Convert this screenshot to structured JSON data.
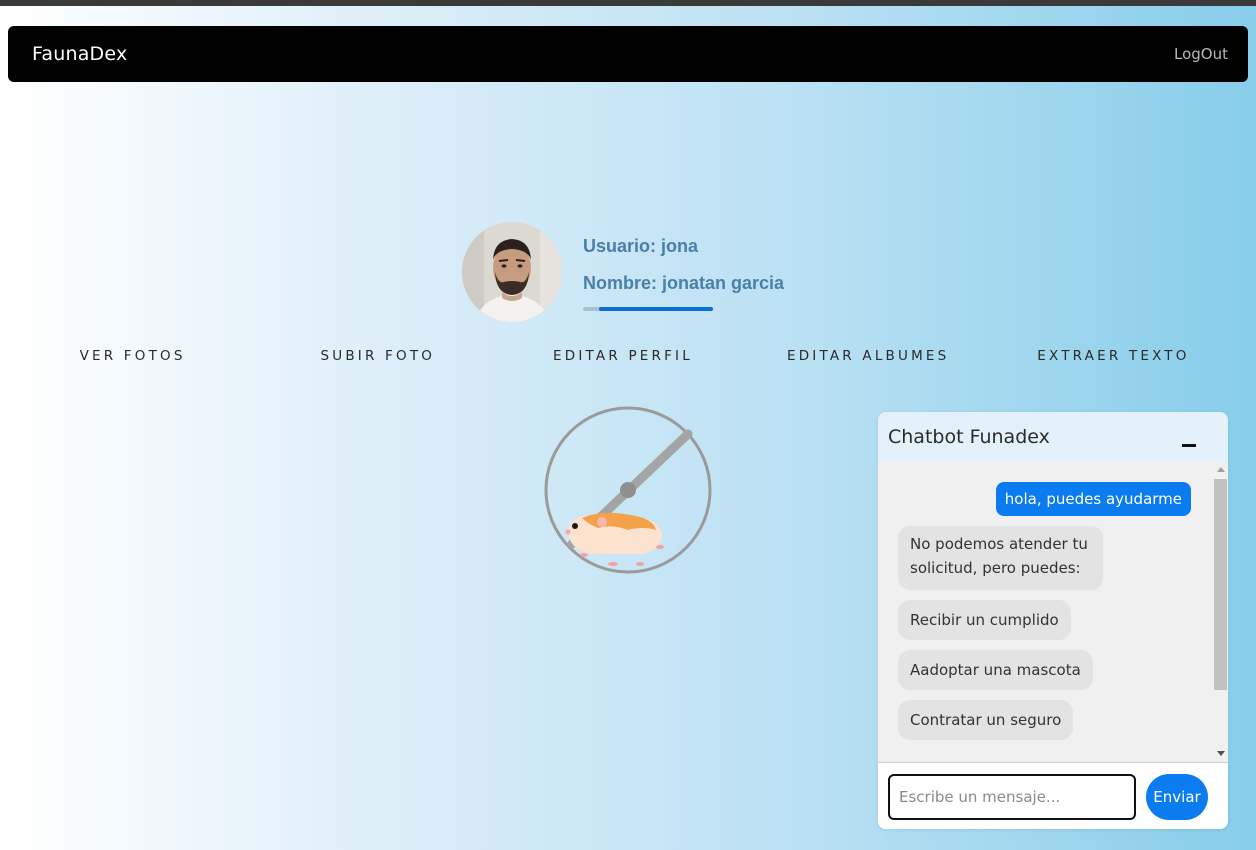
{
  "app": {
    "brand": "FaunaDex",
    "logout_label": "LogOut"
  },
  "profile": {
    "user_line": "Usuario: jona",
    "name_line": "Nombre: jonatan garcia",
    "progress_fraction": 0.88
  },
  "menu": {
    "items": [
      {
        "label": "VER FOTOS"
      },
      {
        "label": "SUBIR FOTO"
      },
      {
        "label": "EDITAR PERFIL"
      },
      {
        "label": "EDITAR ALBUMES"
      },
      {
        "label": "EXTRAER TEXTO"
      }
    ]
  },
  "loader": {
    "icon": "hamster-wheel-icon"
  },
  "chat": {
    "title": "Chatbot Funadex",
    "minimize_icon": "minimize-icon",
    "messages": [
      {
        "from": "user",
        "text": "hola, puedes ayudarme"
      },
      {
        "from": "bot",
        "text_line1": "No podemos atender tu",
        "text_line2": "solicitud, pero puedes:"
      },
      {
        "from": "bot",
        "text": "Recibir un cumplido"
      },
      {
        "from": "bot",
        "text": "Aadoptar una mascota"
      },
      {
        "from": "bot",
        "text": "Contratar un seguro"
      }
    ],
    "input_placeholder": "Escribe un mensaje...",
    "send_label": "Enviar"
  },
  "colors": {
    "accent": "#0a7cf0",
    "navbar": "#000000",
    "profile_text": "#4a7faa",
    "chat_header": "#e2f1fa"
  }
}
